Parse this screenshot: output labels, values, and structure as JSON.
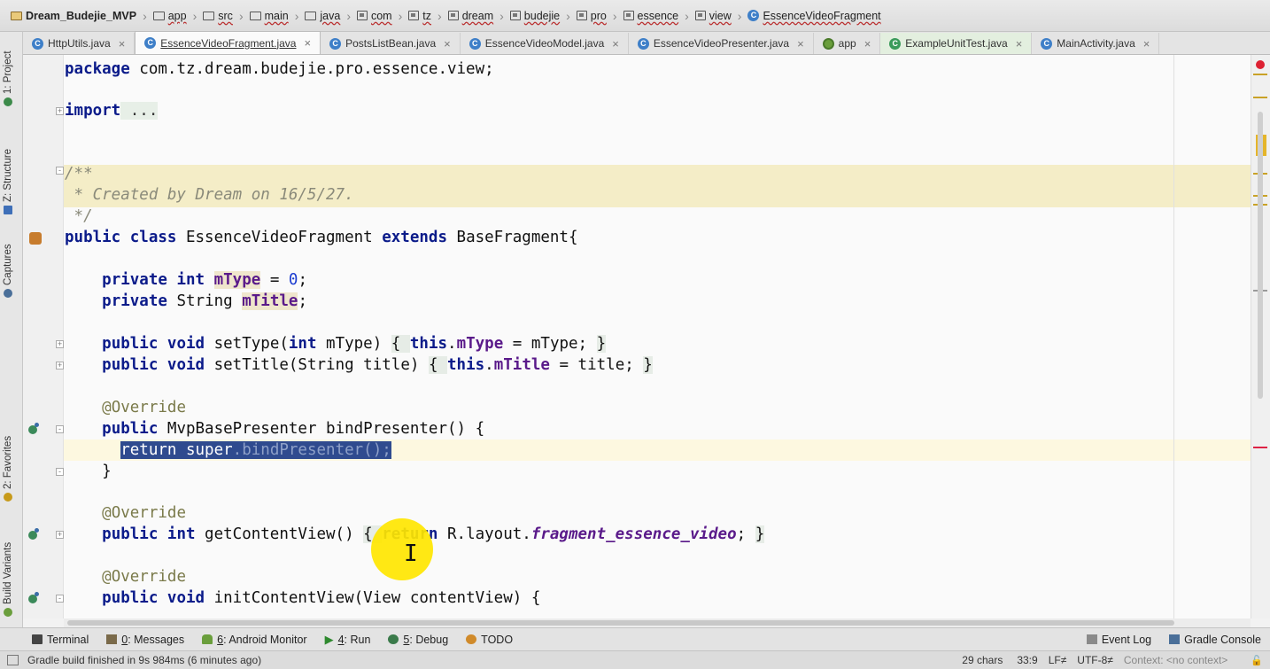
{
  "breadcrumb": [
    {
      "label": "Dream_Budejie_MVP",
      "kind": "project"
    },
    {
      "label": "app",
      "kind": "module"
    },
    {
      "label": "src",
      "kind": "folder"
    },
    {
      "label": "main",
      "kind": "folder"
    },
    {
      "label": "java",
      "kind": "folder"
    },
    {
      "label": "com",
      "kind": "package"
    },
    {
      "label": "tz",
      "kind": "package"
    },
    {
      "label": "dream",
      "kind": "package"
    },
    {
      "label": "budejie",
      "kind": "package"
    },
    {
      "label": "pro",
      "kind": "package"
    },
    {
      "label": "essence",
      "kind": "package"
    },
    {
      "label": "view",
      "kind": "package"
    },
    {
      "label": "EssenceVideoFragment",
      "kind": "class"
    }
  ],
  "tabs": [
    {
      "label": "HttpUtils.java",
      "icon": "class-icon",
      "active": false
    },
    {
      "label": "EssenceVideoFragment.java",
      "icon": "class-icon",
      "active": true
    },
    {
      "label": "PostsListBean.java",
      "icon": "class-icon",
      "active": false
    },
    {
      "label": "EssenceVideoModel.java",
      "icon": "class-icon",
      "active": false
    },
    {
      "label": "EssenceVideoPresenter.java",
      "icon": "class-icon",
      "active": false
    },
    {
      "label": "app",
      "icon": "android-app-icon",
      "active": false
    },
    {
      "label": "ExampleUnitTest.java",
      "icon": "test-class-icon",
      "active": false
    },
    {
      "label": "MainActivity.java",
      "icon": "class-icon",
      "active": false
    }
  ],
  "left_tools": [
    {
      "label": "1: Project"
    },
    {
      "label": "Z: Structure"
    },
    {
      "label": "Captures"
    },
    {
      "label": "2: Favorites"
    },
    {
      "label": "Build Variants"
    }
  ],
  "code": {
    "package_kw": "package",
    "package_name": " com.tz.dream.budejie.pro.essence.view;",
    "import_kw": "import",
    "import_folded": " ...",
    "doc_open": "/**",
    "doc_text": " * Created by Dream on 16/5/27.",
    "doc_close": " */",
    "class_decl_1": "public class",
    "class_name": " EssenceVideoFragment ",
    "class_extends": "extends",
    "class_base": " BaseFragment{",
    "f1_mod": "private int",
    "f1_name": "mType",
    "f1_eq": " = ",
    "f1_val": "0",
    "f1_end": ";",
    "f2_mod": "private",
    "f2_type": " String ",
    "f2_name": "mTitle",
    "f2_end": ";",
    "m1_mod": "public void",
    "m1_sig_a": " setType(",
    "m1_int": "int",
    "m1_sig_b": " mType) ",
    "m1_body_open": "{ ",
    "m1_this": "this",
    "m1_dot": ".",
    "m1_fld": "mType",
    "m1_rest": " = mType; ",
    "m1_close": "}",
    "m2_mod": "public void",
    "m2_sig": " setTitle(String title) ",
    "m2_body_open": "{ ",
    "m2_this": "this",
    "m2_dot": ".",
    "m2_fld": "mTitle",
    "m2_rest": " = title; ",
    "m2_close": "}",
    "ann1": "@Override",
    "m3_mod": "public",
    "m3_sig": " MvpBasePresenter bindPresenter() {",
    "m3_ret": "return",
    "m3_sp": " ",
    "m3_super": "super",
    "m3_call": ".bindPresenter();",
    "m3_close": "}",
    "ann2": "@Override",
    "m4_mod": "public int",
    "m4_sig": " getContentView() ",
    "m4_open": "{ ",
    "m4_ret": "return",
    "m4_r": " R.layout.",
    "m4_layout": "fragment_essence_video",
    "m4_end": "; ",
    "m4_close": "}",
    "ann3": "@Override",
    "m5_mod": "public void",
    "m5_sig": " initContentView(View contentView) {"
  },
  "bottom_tools": [
    {
      "key": "",
      "label": "Terminal",
      "icon": "terminal-icon"
    },
    {
      "key": "0",
      "label": ": Messages",
      "icon": "messages-icon"
    },
    {
      "key": "6",
      "label": ": Android Monitor",
      "icon": "android-icon"
    },
    {
      "key": "4",
      "label": ": Run",
      "icon": "run-icon"
    },
    {
      "key": "5",
      "label": ": Debug",
      "icon": "debug-icon"
    },
    {
      "key": "",
      "label": "TODO",
      "icon": "todo-icon"
    }
  ],
  "right_tools": [
    {
      "label": "Event Log",
      "icon": "event-log-icon"
    },
    {
      "label": "Gradle Console",
      "icon": "gradle-console-icon"
    }
  ],
  "status": {
    "message": "Gradle build finished in 9s 984ms (6 minutes ago)",
    "chars": "29 chars",
    "position": "33:9",
    "line_sep": "LF≠",
    "encoding": "UTF-8≠",
    "context": "Context: <no context>"
  }
}
